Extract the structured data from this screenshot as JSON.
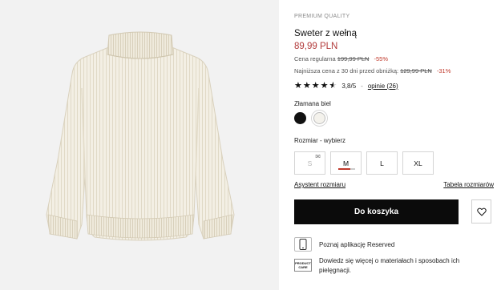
{
  "product": {
    "brand_line": "PREMIUM QUALITY",
    "title": "Sweter z wełną",
    "price": "89,99 PLN",
    "image_icon": "sweater-image"
  },
  "pricing": {
    "regular_label": "Cena regularna",
    "regular_value": "199,99 PLN",
    "regular_discount": "-55%",
    "lowest_label": "Najniższa cena z 30 dni przed obniżką:",
    "lowest_value": "129,99 PLN",
    "lowest_discount": "-31%"
  },
  "rating": {
    "value": 3.8,
    "value_text": "3,8/5",
    "separator": "-",
    "reviews_label": "opinie (26)"
  },
  "color": {
    "selected_label": "Złamana biel",
    "options": [
      "#111111",
      "#f4f2ec"
    ]
  },
  "size": {
    "label": "Rozmiar",
    "separator": "-",
    "prompt": "wybierz",
    "options": [
      {
        "label": "S",
        "available": false,
        "notify_icon": "envelope-icon"
      },
      {
        "label": "M",
        "available": true,
        "low_stock_fraction": 0.7
      },
      {
        "label": "L",
        "available": true
      },
      {
        "label": "XL",
        "available": true
      }
    ]
  },
  "links": {
    "size_assistant": "Asystent rozmiaru",
    "size_table": "Tabela rozmiarów"
  },
  "actions": {
    "add_to_cart": "Do koszyka",
    "wishlist_icon": "heart-icon"
  },
  "info": {
    "app_text": "Poznaj aplikację Reserved",
    "app_icon": "smartphone-icon",
    "care_icon_label_1": "PRODUCT",
    "care_icon_label_2": "CARE",
    "care_text": "Dowiedz się więcej o materiałach i sposobach ich pielęgnacji."
  },
  "colors": {
    "accent_price": "#b23a3a",
    "discount": "#c0392b",
    "button": "#0b0b0b"
  }
}
